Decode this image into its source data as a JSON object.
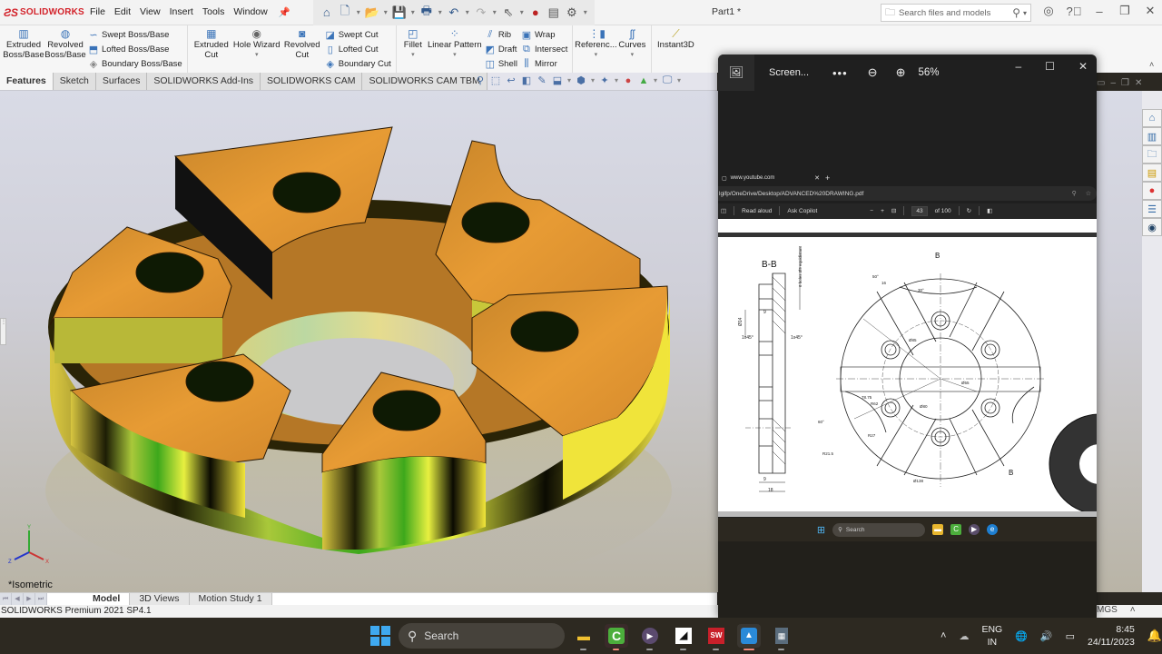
{
  "app": {
    "brand": "SOLIDWORKS",
    "menu": [
      "File",
      "Edit",
      "View",
      "Insert",
      "Tools",
      "Window"
    ],
    "document_title": "Part1 *",
    "search_placeholder": "Search files and models",
    "quick_access_icons": [
      "home-icon",
      "new-document-icon",
      "open-icon",
      "save-icon",
      "print-icon",
      "undo-icon",
      "redo-icon",
      "select-icon",
      "rebuild-icon",
      "file-properties-icon",
      "options-icon"
    ]
  },
  "command_manager": {
    "group1": {
      "extruded_boss": "Extruded Boss/Base",
      "revolved_boss": "Revolved Boss/Base",
      "swept_boss": "Swept Boss/Base",
      "lofted_boss": "Lofted Boss/Base",
      "boundary_boss": "Boundary Boss/Base"
    },
    "group2": {
      "extruded_cut": "Extruded Cut",
      "hole_wizard": "Hole Wizard",
      "revolved_cut": "Revolved Cut",
      "swept_cut": "Swept Cut",
      "lofted_cut": "Lofted Cut",
      "boundary_cut": "Boundary Cut"
    },
    "group3": {
      "fillet": "Fillet",
      "linear_pattern": "Linear Pattern",
      "rib": "Rib",
      "draft": "Draft",
      "shell": "Shell",
      "wrap": "Wrap",
      "intersect": "Intersect",
      "mirror": "Mirror"
    },
    "group4": {
      "reference": "Referenc...",
      "curves": "Curves",
      "instant3d": "Instant3D"
    },
    "tabs": [
      "Features",
      "Sketch",
      "Surfaces",
      "SOLIDWORKS Add-Ins",
      "SOLIDWORKS CAM",
      "SOLIDWORKS CAM TBM"
    ],
    "active_tab": "Features"
  },
  "graphics": {
    "view_label": "*Isometric",
    "triad": {
      "x": "X",
      "y": "Y",
      "z": "Z"
    },
    "part_color": "#e0962e"
  },
  "bottom_tabs": [
    "Model",
    "3D Views",
    "Motion Study 1"
  ],
  "status": {
    "left": "SOLIDWORKS Premium 2021 SP4.1",
    "units": "MGS"
  },
  "photos_viewer": {
    "title": "Screen...",
    "zoom": "56%",
    "browser": {
      "tab_title": "www.youtube.com",
      "url": "lgifp/OneDrive/Desktop/ADVANCED%20DRAWING.pdf",
      "read_aloud": "Read aloud",
      "ask_copilot": "Ask Copilot",
      "page_current": "43",
      "page_total": "of 100"
    },
    "drawing": {
      "section_label": "B-B",
      "section_marker": "B",
      "note": "6 holes Ø9 equidistant",
      "dims": {
        "d14": "Ø14",
        "nine_top": "9",
        "chamfer_left": "1x45°",
        "chamfer_right": "1x45°",
        "nine_bottom": "9",
        "eighteen": "18",
        "ang50": "50°",
        "sixteen": "16",
        "ang30": "30°",
        "d85": "Ø85",
        "d55": "Ø55",
        "d80": "Ø80",
        "r7875": "78.75",
        "r62": "R62",
        "ang60": "60°",
        "r27": "R27",
        "r215": "R21.5",
        "d138": "Ø138"
      }
    },
    "inner_taskbar_search": "Search"
  },
  "taskbar": {
    "search": "Search",
    "apps": [
      "file-explorer",
      "camtasia",
      "media-player",
      "autodesk",
      "solidworks-2021",
      "photos",
      "calculator"
    ],
    "language": [
      "ENG",
      "IN"
    ],
    "time": "8:45",
    "date": "24/11/2023"
  }
}
